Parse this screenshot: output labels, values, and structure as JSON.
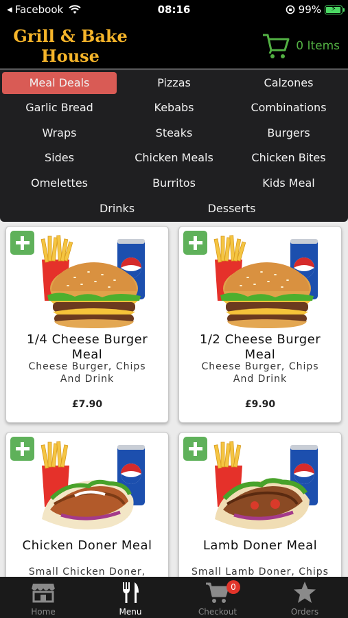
{
  "status": {
    "back_label": "Facebook",
    "time": "08:16",
    "battery": "99%",
    "battery_level": 0.99
  },
  "header": {
    "logo_line1": "Grill & Bake",
    "logo_line2": "House",
    "cart_label": "0 Items"
  },
  "categories": [
    "Meal Deals",
    "Pizzas",
    "Calzones",
    "Garlic Bread",
    "Kebabs",
    "Combinations",
    "Wraps",
    "Steaks",
    "Burgers",
    "Sides",
    "Chicken Meals",
    "Chicken Bites",
    "Omelettes",
    "Burritos",
    "Kids Meal",
    "Drinks",
    "Desserts"
  ],
  "active_category": "Meal Deals",
  "products": [
    {
      "title_line1": "1/4 Cheese Burger",
      "title_line2": "Meal",
      "desc_line1": "Cheese Burger, Chips",
      "desc_line2": "And Drink",
      "price": "£7.90",
      "image": "burger-meal-image"
    },
    {
      "title_line1": "1/2 Cheese Burger",
      "title_line2": "Meal",
      "desc_line1": "Cheese Burger, Chips",
      "desc_line2": "And Drink",
      "price": "£9.90",
      "image": "burger-meal-image"
    },
    {
      "title_line1": "Chicken Doner Meal",
      "desc_line1": "Small Chicken Doner,",
      "image": "doner-meal-image"
    },
    {
      "title_line1": "Lamb Doner Meal",
      "desc_line1": "Small Lamb Doner, Chips",
      "image": "doner-meal-image"
    }
  ],
  "tabs": [
    {
      "label": "Home",
      "icon": "store-icon"
    },
    {
      "label": "Menu",
      "icon": "fork-knife-icon"
    },
    {
      "label": "Checkout",
      "icon": "cart-icon",
      "badge": "0"
    },
    {
      "label": "Orders",
      "icon": "star-icon"
    }
  ],
  "colors": {
    "accent": "#d95b55",
    "logo": "#f6b52a",
    "cart_green": "#52b043",
    "add_green": "#5fb15a",
    "badge_red": "#e1342a"
  }
}
